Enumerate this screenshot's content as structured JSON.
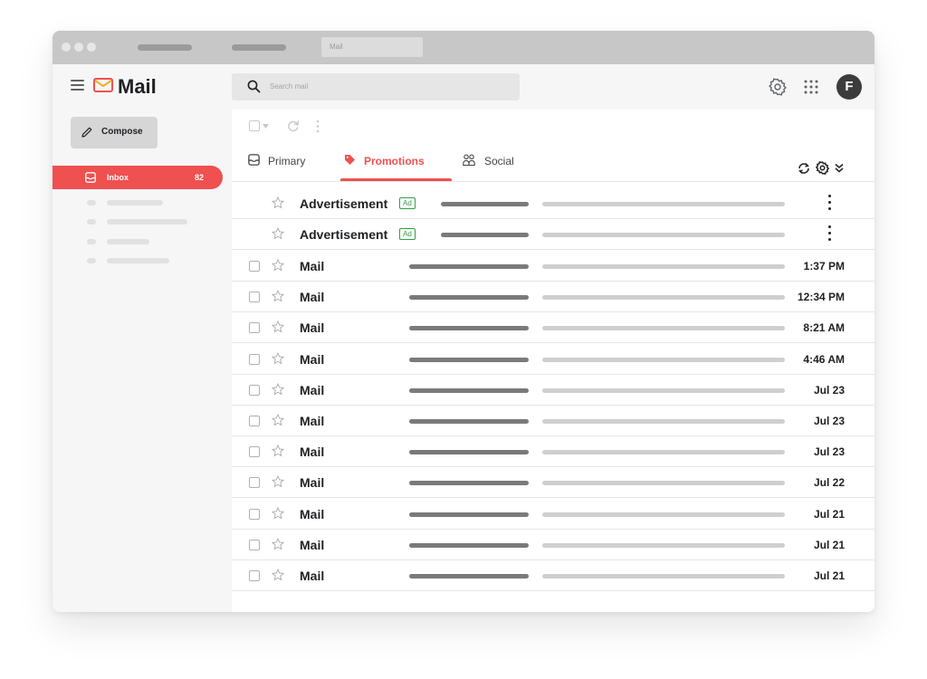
{
  "window": {
    "tab_title": "Mail"
  },
  "header": {
    "app_name": "Mail",
    "search_placeholder": "Search mail",
    "avatar_initial": "F"
  },
  "sidebar": {
    "compose_label": "Compose",
    "inbox_label": "Inbox",
    "inbox_count": "82"
  },
  "tabs": [
    {
      "label": "Primary",
      "icon": "inbox-icon",
      "active": false
    },
    {
      "label": "Promotions",
      "icon": "tag-icon",
      "active": true
    },
    {
      "label": "Social",
      "icon": "people-icon",
      "active": false
    }
  ],
  "ads": [
    {
      "sender": "Advertisement",
      "badge": "Ad"
    },
    {
      "sender": "Advertisement",
      "badge": "Ad"
    }
  ],
  "emails": [
    {
      "sender": "Mail",
      "time": "1:37 PM"
    },
    {
      "sender": "Mail",
      "time": "12:34 PM"
    },
    {
      "sender": "Mail",
      "time": "8:21 AM"
    },
    {
      "sender": "Mail",
      "time": "4:46 AM"
    },
    {
      "sender": "Mail",
      "time": "Jul 23"
    },
    {
      "sender": "Mail",
      "time": "Jul 23"
    },
    {
      "sender": "Mail",
      "time": "Jul 23"
    },
    {
      "sender": "Mail",
      "time": "Jul 22"
    },
    {
      "sender": "Mail",
      "time": "Jul 21"
    },
    {
      "sender": "Mail",
      "time": "Jul 21"
    },
    {
      "sender": "Mail",
      "time": "Jul 21"
    }
  ],
  "colors": {
    "accent": "#ef5050",
    "ad_badge": "#2ea043",
    "logo_yellow": "#f2b01e"
  }
}
